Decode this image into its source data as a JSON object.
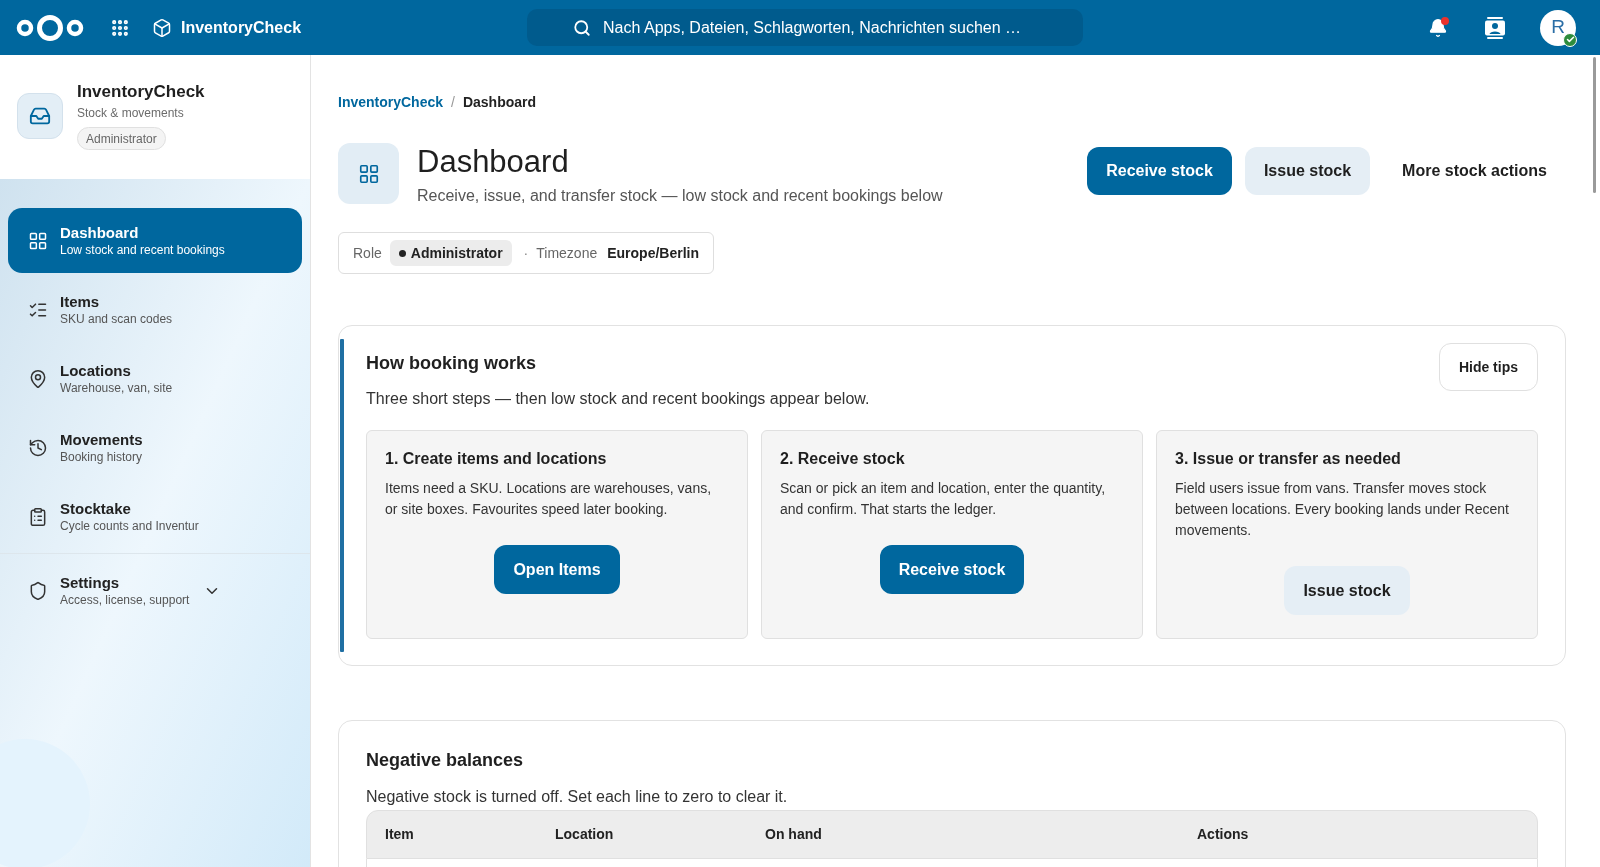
{
  "top_bar": {
    "app_name": "InventoryCheck",
    "search": {
      "placeholder": "Nach Apps, Dateien, Schlagworten, Nachrichten suchen …"
    },
    "notifications": {
      "unread": true
    },
    "avatar": {
      "initial": "R",
      "online": true
    }
  },
  "sidebar": {
    "app": {
      "title": "InventoryCheck",
      "subtitle": "Stock & movements",
      "badge": "Administrator"
    },
    "items": [
      {
        "label": "Dashboard",
        "description": "Low stock and recent bookings",
        "selected": true
      },
      {
        "label": "Items",
        "description": "SKU and scan codes",
        "selected": false
      },
      {
        "label": "Locations",
        "description": "Warehouse, van, site",
        "selected": false
      },
      {
        "label": "Movements",
        "description": "Booking history",
        "selected": false
      },
      {
        "label": "Stocktake",
        "description": "Cycle counts and Inventur",
        "selected": false
      }
    ],
    "settings": {
      "label": "Settings",
      "description": "Access, license, support",
      "selected": false,
      "expanded": false
    }
  },
  "breadcrumb": {
    "separator": "/",
    "items": [
      {
        "label": "InventoryCheck",
        "kind": "link"
      },
      {
        "label": "Dashboard",
        "kind": "current"
      }
    ]
  },
  "header": {
    "title": "Dashboard",
    "subtitle": "Receive, issue, and transfer stock — low stock and recent bookings below",
    "actions": [
      {
        "label": "Receive stock",
        "kind": "primary"
      },
      {
        "label": "Issue stock",
        "kind": "secondary"
      },
      {
        "label": "More stock actions",
        "kind": "tertiary"
      }
    ]
  },
  "context": {
    "role_label": "Role",
    "role": "Administrator",
    "separator": "·",
    "timezone_label": "Timezone",
    "timezone": "Europe/Berlin"
  },
  "tips": {
    "title": "How booking works",
    "subtitle": "Three short steps — then low stock and recent bookings appear below.",
    "hide_button": "Hide tips",
    "steps": [
      {
        "title": "1. Create items and locations",
        "text": "Items need a SKU. Locations are warehouses, vans, or site boxes. Favourites speed later booking.",
        "button": {
          "label": "Open Items",
          "kind": "primary"
        }
      },
      {
        "title": "2. Receive stock",
        "text": "Scan or pick an item and location, enter the quantity, and confirm. That starts the ledger.",
        "button": {
          "label": "Receive stock",
          "kind": "primary"
        }
      },
      {
        "title": "3. Issue or transfer as needed",
        "text": "Field users issue from vans. Transfer moves stock between locations. Every booking lands under Recent movements.",
        "button": {
          "label": "Issue stock",
          "kind": "secondary"
        }
      }
    ]
  },
  "negative_balances": {
    "title": "Negative balances",
    "subtitle": "Negative stock is turned off. Set each line to zero to clear it.",
    "table": {
      "columns": [
        "Item",
        "Location",
        "On hand",
        "Actions"
      ]
    }
  }
}
